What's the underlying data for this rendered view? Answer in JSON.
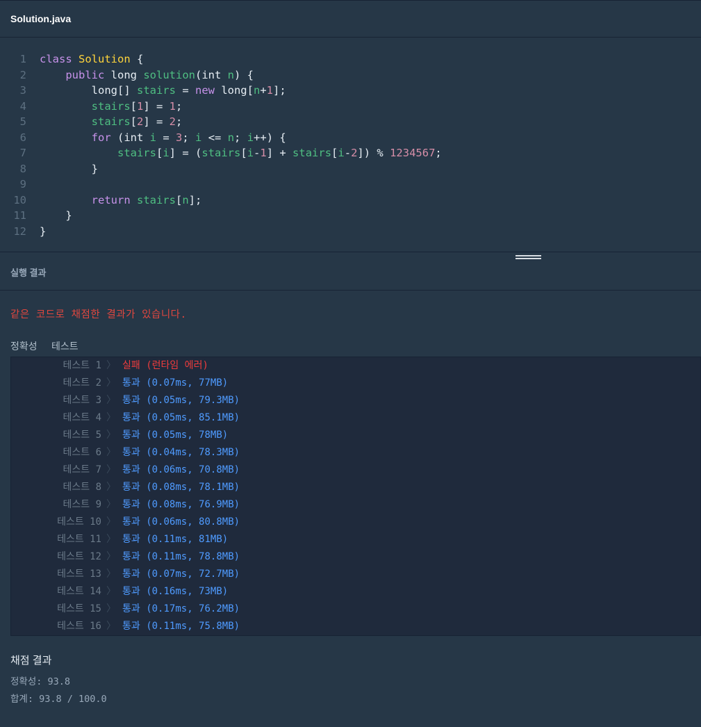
{
  "file_tab": {
    "name": "Solution.java"
  },
  "code": {
    "lines": [
      [
        {
          "t": "class ",
          "c": "kw"
        },
        {
          "t": "Solution",
          "c": "cls"
        },
        {
          "t": " {",
          "c": "punct"
        }
      ],
      [
        {
          "t": "    ",
          "c": "punct"
        },
        {
          "t": "public ",
          "c": "kw"
        },
        {
          "t": "long ",
          "c": "punct"
        },
        {
          "t": "solution",
          "c": "fn"
        },
        {
          "t": "(",
          "c": "punct"
        },
        {
          "t": "int ",
          "c": "punct"
        },
        {
          "t": "n",
          "c": "var"
        },
        {
          "t": ") {",
          "c": "punct"
        }
      ],
      [
        {
          "t": "        long[] ",
          "c": "punct"
        },
        {
          "t": "stairs",
          "c": "var"
        },
        {
          "t": " = ",
          "c": "punct"
        },
        {
          "t": "new ",
          "c": "kw"
        },
        {
          "t": "long[",
          "c": "punct"
        },
        {
          "t": "n",
          "c": "var"
        },
        {
          "t": "+",
          "c": "punct"
        },
        {
          "t": "1",
          "c": "num"
        },
        {
          "t": "];",
          "c": "punct"
        }
      ],
      [
        {
          "t": "        ",
          "c": "punct"
        },
        {
          "t": "stairs",
          "c": "var"
        },
        {
          "t": "[",
          "c": "punct"
        },
        {
          "t": "1",
          "c": "num"
        },
        {
          "t": "] = ",
          "c": "punct"
        },
        {
          "t": "1",
          "c": "num"
        },
        {
          "t": ";",
          "c": "punct"
        }
      ],
      [
        {
          "t": "        ",
          "c": "punct"
        },
        {
          "t": "stairs",
          "c": "var"
        },
        {
          "t": "[",
          "c": "punct"
        },
        {
          "t": "2",
          "c": "num"
        },
        {
          "t": "] = ",
          "c": "punct"
        },
        {
          "t": "2",
          "c": "num"
        },
        {
          "t": ";",
          "c": "punct"
        }
      ],
      [
        {
          "t": "        ",
          "c": "punct"
        },
        {
          "t": "for ",
          "c": "kw"
        },
        {
          "t": "(int ",
          "c": "punct"
        },
        {
          "t": "i",
          "c": "var"
        },
        {
          "t": " = ",
          "c": "punct"
        },
        {
          "t": "3",
          "c": "num"
        },
        {
          "t": "; ",
          "c": "punct"
        },
        {
          "t": "i",
          "c": "var"
        },
        {
          "t": " <= ",
          "c": "punct"
        },
        {
          "t": "n",
          "c": "var"
        },
        {
          "t": "; ",
          "c": "punct"
        },
        {
          "t": "i",
          "c": "var"
        },
        {
          "t": "++) {",
          "c": "punct"
        }
      ],
      [
        {
          "t": "            ",
          "c": "punct"
        },
        {
          "t": "stairs",
          "c": "var"
        },
        {
          "t": "[",
          "c": "punct"
        },
        {
          "t": "i",
          "c": "var"
        },
        {
          "t": "] = (",
          "c": "punct"
        },
        {
          "t": "stairs",
          "c": "var"
        },
        {
          "t": "[",
          "c": "punct"
        },
        {
          "t": "i",
          "c": "var"
        },
        {
          "t": "-",
          "c": "punct"
        },
        {
          "t": "1",
          "c": "num"
        },
        {
          "t": "] + ",
          "c": "punct"
        },
        {
          "t": "stairs",
          "c": "var"
        },
        {
          "t": "[",
          "c": "punct"
        },
        {
          "t": "i",
          "c": "var"
        },
        {
          "t": "-",
          "c": "punct"
        },
        {
          "t": "2",
          "c": "num"
        },
        {
          "t": "]) % ",
          "c": "punct"
        },
        {
          "t": "1234567",
          "c": "num"
        },
        {
          "t": ";",
          "c": "punct"
        }
      ],
      [
        {
          "t": "        }",
          "c": "punct"
        }
      ],
      [],
      [
        {
          "t": "        ",
          "c": "punct"
        },
        {
          "t": "return ",
          "c": "kw"
        },
        {
          "t": "stairs",
          "c": "var"
        },
        {
          "t": "[",
          "c": "punct"
        },
        {
          "t": "n",
          "c": "var"
        },
        {
          "t": "];",
          "c": "punct"
        }
      ],
      [
        {
          "t": "    }",
          "c": "punct"
        }
      ],
      [
        {
          "t": "}",
          "c": "punct"
        }
      ]
    ],
    "colors": {
      "kw": "#c792ea",
      "cls": "#ffd43b",
      "fn": "#4fbf82",
      "var": "#4fbf82",
      "num": "#d68ea8",
      "punct": "#e6edf3"
    }
  },
  "results": {
    "title": "실행 결과",
    "notice": "같은 코드로 채점한 결과가 있습니다.",
    "accuracy_label": "정확성",
    "test_label": "테스트",
    "tests": [
      {
        "name": "테스트 1",
        "result": "실패 (런타임 에러)",
        "status": "fail"
      },
      {
        "name": "테스트 2",
        "result": "통과 (0.07ms, 77MB)",
        "status": "pass"
      },
      {
        "name": "테스트 3",
        "result": "통과 (0.05ms, 79.3MB)",
        "status": "pass"
      },
      {
        "name": "테스트 4",
        "result": "통과 (0.05ms, 85.1MB)",
        "status": "pass"
      },
      {
        "name": "테스트 5",
        "result": "통과 (0.05ms, 78MB)",
        "status": "pass"
      },
      {
        "name": "테스트 6",
        "result": "통과 (0.04ms, 78.3MB)",
        "status": "pass"
      },
      {
        "name": "테스트 7",
        "result": "통과 (0.06ms, 70.8MB)",
        "status": "pass"
      },
      {
        "name": "테스트 8",
        "result": "통과 (0.08ms, 78.1MB)",
        "status": "pass"
      },
      {
        "name": "테스트 9",
        "result": "통과 (0.08ms, 76.9MB)",
        "status": "pass"
      },
      {
        "name": "테스트 10",
        "result": "통과 (0.06ms, 80.8MB)",
        "status": "pass"
      },
      {
        "name": "테스트 11",
        "result": "통과 (0.11ms, 81MB)",
        "status": "pass"
      },
      {
        "name": "테스트 12",
        "result": "통과 (0.11ms, 78.8MB)",
        "status": "pass"
      },
      {
        "name": "테스트 13",
        "result": "통과 (0.07ms, 72.7MB)",
        "status": "pass"
      },
      {
        "name": "테스트 14",
        "result": "통과 (0.16ms, 73MB)",
        "status": "pass"
      },
      {
        "name": "테스트 15",
        "result": "통과 (0.17ms, 76.2MB)",
        "status": "pass"
      },
      {
        "name": "테스트 16",
        "result": "통과 (0.11ms, 75.8MB)",
        "status": "pass"
      }
    ],
    "chevron": "〉",
    "status_colors": {
      "fail": "#f03c3c",
      "pass": "#4f9bff"
    }
  },
  "summary": {
    "title": "채점 결과",
    "accuracy": "정확성: 93.8",
    "total": "합계: 93.8 / 100.0"
  }
}
